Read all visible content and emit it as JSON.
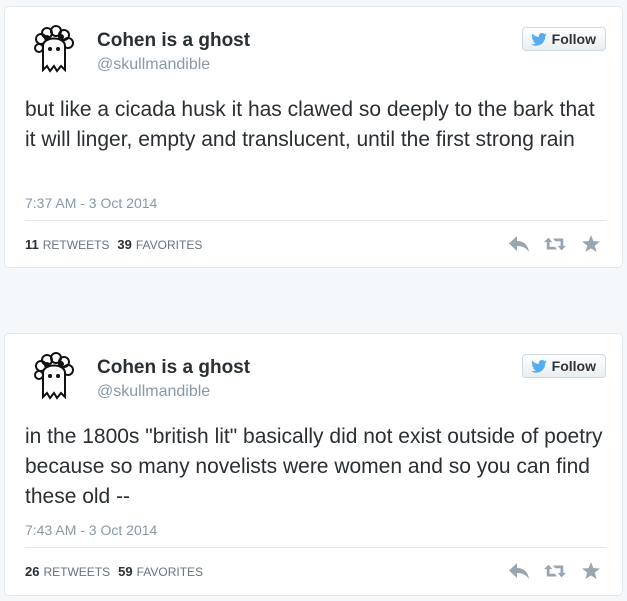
{
  "tweets": [
    {
      "display_name": "Cohen is a ghost",
      "screen_name": "@skullmandible",
      "follow_label": "Follow",
      "text": "but like a cicada husk it has clawed so deeply to the bark that it will linger, empty and translucent, until the first strong rain",
      "timestamp": "7:37 AM - 3 Oct 2014",
      "retweets_count": "11",
      "retweets_label": "RETWEETS",
      "favorites_count": "39",
      "favorites_label": "FAVORITES"
    },
    {
      "display_name": "Cohen is a ghost",
      "screen_name": "@skullmandible",
      "follow_label": "Follow",
      "text": "in the 1800s \"british lit\" basically did not exist outside of poetry because so many novelists were women and so you can find these old --",
      "timestamp": "7:43 AM - 3 Oct 2014",
      "retweets_count": "26",
      "retweets_label": "RETWEETS",
      "favorites_count": "59",
      "favorites_label": "FAVORITES"
    }
  ],
  "colors": {
    "twitter_blue": "#55acee",
    "icon_gray": "#99a6b0",
    "muted_text": "#8899a6"
  },
  "icons": [
    "ghost-avatar",
    "twitter-bird-icon",
    "reply-icon",
    "retweet-icon",
    "favorite-star-icon"
  ]
}
